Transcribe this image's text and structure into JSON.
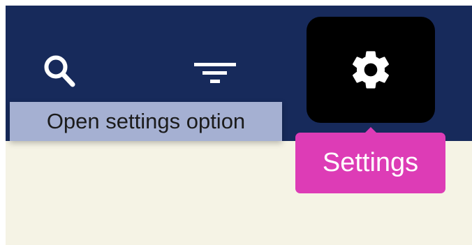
{
  "toolbar": {
    "background": "#172a5b",
    "buttons": [
      {
        "icon": "search-icon"
      },
      {
        "icon": "filter-icon"
      },
      {
        "icon": "gear-icon",
        "active": true
      }
    ]
  },
  "tooltips": {
    "hint": "Open settings option",
    "settings": "Settings"
  },
  "colors": {
    "content_background": "#f5f3e5",
    "hint_background": "#a5b0d2",
    "settings_tooltip_background": "#dd3cb6",
    "active_button_background": "#000000",
    "icon": "#ffffff"
  }
}
